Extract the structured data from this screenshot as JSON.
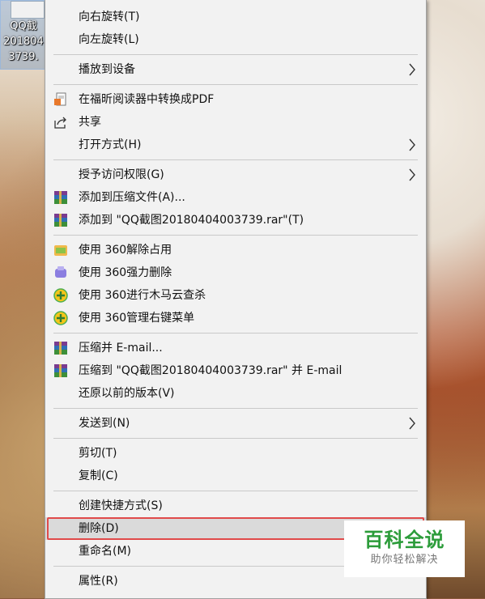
{
  "desktop_icon": {
    "label_lines": [
      "QQ截",
      "201804",
      "3739."
    ]
  },
  "menu": {
    "items": [
      {
        "label": "向右旋转(T)",
        "icon": null,
        "submenu": false
      },
      {
        "label": "向左旋转(L)",
        "icon": null,
        "submenu": false
      },
      {
        "label": "播放到设备",
        "icon": null,
        "submenu": true
      },
      {
        "label": "在福昕阅读器中转换成PDF",
        "icon": "pdf-convert-icon",
        "submenu": false
      },
      {
        "label": "共享",
        "icon": "share-icon",
        "submenu": false
      },
      {
        "label": "打开方式(H)",
        "icon": null,
        "submenu": true
      },
      {
        "label": "授予访问权限(G)",
        "icon": null,
        "submenu": true
      },
      {
        "label": "添加到压缩文件(A)...",
        "icon": "winrar-icon",
        "submenu": false
      },
      {
        "label": "添加到 \"QQ截图20180404003739.rar\"(T)",
        "icon": "winrar-icon",
        "submenu": false
      },
      {
        "label": "使用 360解除占用",
        "icon": "360-unlock-icon",
        "submenu": false
      },
      {
        "label": "使用 360强力删除",
        "icon": "360-shred-icon",
        "submenu": false
      },
      {
        "label": "使用 360进行木马云查杀",
        "icon": "360-plus-icon",
        "submenu": false
      },
      {
        "label": "使用 360管理右键菜单",
        "icon": "360-plus-icon",
        "submenu": false
      },
      {
        "label": "压缩并 E-mail...",
        "icon": "winrar-icon",
        "submenu": false
      },
      {
        "label": "压缩到 \"QQ截图20180404003739.rar\" 并 E-mail",
        "icon": "winrar-icon",
        "submenu": false
      },
      {
        "label": "还原以前的版本(V)",
        "icon": null,
        "submenu": false
      },
      {
        "label": "发送到(N)",
        "icon": null,
        "submenu": true
      },
      {
        "label": "剪切(T)",
        "icon": null,
        "submenu": false
      },
      {
        "label": "复制(C)",
        "icon": null,
        "submenu": false
      },
      {
        "label": "创建快捷方式(S)",
        "icon": null,
        "submenu": false
      },
      {
        "label": "删除(D)",
        "icon": null,
        "submenu": false,
        "highlighted": true
      },
      {
        "label": "重命名(M)",
        "icon": null,
        "submenu": false
      },
      {
        "label": "属性(R)",
        "icon": null,
        "submenu": false
      }
    ]
  },
  "watermark": {
    "title": "百科全说",
    "subtitle": "助你轻松解决"
  },
  "colors": {
    "menu_bg": "#f2f2f2",
    "highlight_border": "#e04a4a",
    "watermark_green": "#2c9c3a"
  }
}
